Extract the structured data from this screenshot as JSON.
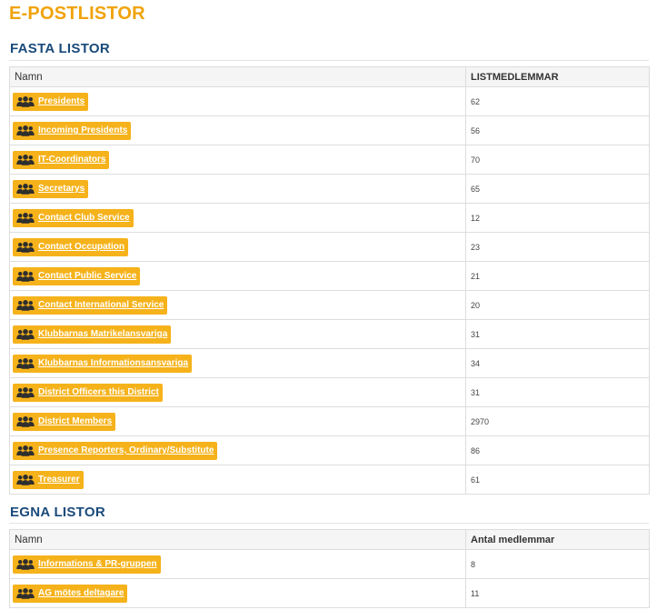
{
  "page_title": "E-POSTLISTOR",
  "fasta": {
    "title": "FASTA LISTOR",
    "header": {
      "name": "Namn",
      "count": "LISTMEDLEMMAR"
    },
    "rows": [
      {
        "label": "Presidents",
        "count": "62"
      },
      {
        "label": "Incoming Presidents",
        "count": "56"
      },
      {
        "label": "IT-Coordinators",
        "count": "70"
      },
      {
        "label": "Secretarys",
        "count": "65"
      },
      {
        "label": "Contact Club Service",
        "count": "12"
      },
      {
        "label": "Contact Occupation",
        "count": "23"
      },
      {
        "label": "Contact Public Service",
        "count": "21"
      },
      {
        "label": "Contact International Service",
        "count": "20"
      },
      {
        "label": "Klubbarnas Matrikelansvariga",
        "count": "31"
      },
      {
        "label": "Klubbarnas Informationsansvariga",
        "count": "34"
      },
      {
        "label": "District Officers this District",
        "count": "31"
      },
      {
        "label": "District Members",
        "count": "2970"
      },
      {
        "label": "Presence Reporters, Ordinary/Substitute",
        "count": "86"
      },
      {
        "label": "Treasurer",
        "count": "61"
      }
    ]
  },
  "egna": {
    "title": "EGNA LISTOR",
    "header": {
      "name": "Namn",
      "count": "Antal medlemmar"
    },
    "rows": [
      {
        "label": "Informations & PR-gruppen",
        "count": "8"
      },
      {
        "label": "AG mötes deltagare",
        "count": "11"
      }
    ]
  },
  "icons": {
    "group": "users-group-icon"
  },
  "colors": {
    "accent": "#f0a30a",
    "chip": "#f5b21a",
    "section": "#1a4a7a"
  }
}
